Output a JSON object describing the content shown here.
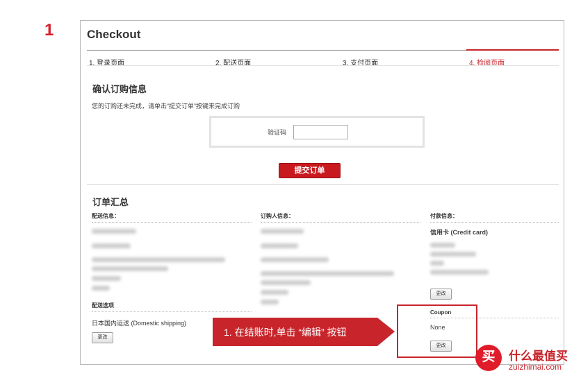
{
  "step_number": "1",
  "checkout": {
    "title": "Checkout",
    "steps": [
      "1. 登录页面",
      "2. 配送页面",
      "3. 支付页面",
      "4. 检阅页面"
    ],
    "confirm_heading": "确认订购信息",
    "confirm_desc": "您的订购还未完成，请单击“提交订单”按键来完成订购",
    "captcha_label": "验证码",
    "captcha_value": "",
    "submit_button": "提交订单"
  },
  "summary": {
    "heading": "订单汇总",
    "shipping_info_head": "配送信息：",
    "orderer_info_head": "订购人信息：",
    "payment_info_head": "付款信息：",
    "payment_method": "信用卡 (Credit card)",
    "payment_edit": "更改",
    "shipping_option_head": "配送选项",
    "shipping_option_value": "日本国内运送 (Domestic shipping)",
    "shipping_option_edit": "更改",
    "coupon_head": "Coupon",
    "coupon_value": "None",
    "coupon_edit": "更改"
  },
  "callout": {
    "text": "1. 在结账时,单击 “编辑” 按钮",
    "color": "#c8242b"
  },
  "watermark": {
    "logo_char": "买",
    "name": "什么最值买",
    "domain": "zuizhimai.com"
  },
  "colors": {
    "accent": "#c8242b",
    "submit_button": "#c8191f"
  }
}
